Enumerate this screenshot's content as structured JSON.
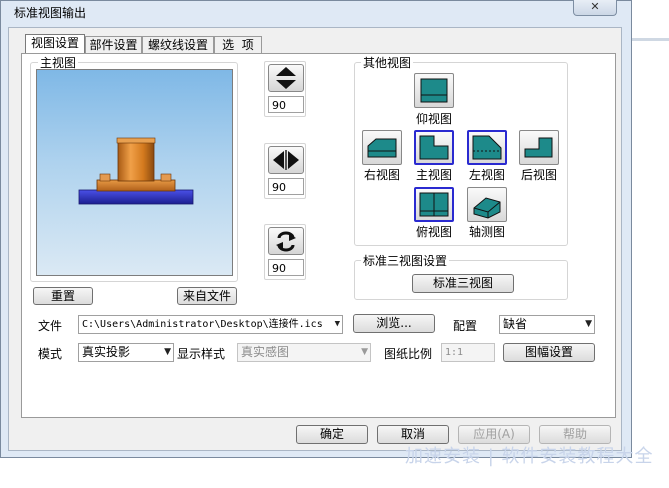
{
  "window": {
    "title": "标准视图输出",
    "close_symbol": "✕"
  },
  "tabs": [
    "视图设置",
    "部件设置",
    "螺纹线设置",
    "选  项"
  ],
  "main_view": {
    "label": "主视图",
    "reset": "重置",
    "from_file": "来自文件"
  },
  "controls": {
    "tilt_value": "90",
    "rotate_value": "90",
    "spin_value": "90"
  },
  "other_views": {
    "label": "其他视图",
    "bottom": "仰视图",
    "right": "右视图",
    "front": "主视图",
    "left": "左视图",
    "back": "后视图",
    "top": "俯视图",
    "axonometric": "轴测图"
  },
  "standard_views": {
    "label": "标准三视图设置",
    "button": "标准三视图"
  },
  "form": {
    "file_label": "文件",
    "file_path": "C:\\Users\\Administrator\\Desktop\\连接件.ics",
    "browse": "浏览...",
    "config_label": "配置",
    "config_value": "缺省",
    "mode_label": "模式",
    "mode_value": "真实投影",
    "display_label": "显示样式",
    "display_value": "真实感图",
    "scale_label": "图纸比例",
    "scale_value": "1:1",
    "frame_button": "图幅设置"
  },
  "footer": {
    "ok": "确定",
    "cancel": "取消",
    "apply": "应用(A)",
    "help": "帮助"
  },
  "watermark": "加速安装 | 软件安装教程大全",
  "colors": {
    "model_body": "#d47a1e",
    "model_base": "#3035c8",
    "view_icon": "#1d8a8a",
    "selection": "#2a2ad0"
  }
}
